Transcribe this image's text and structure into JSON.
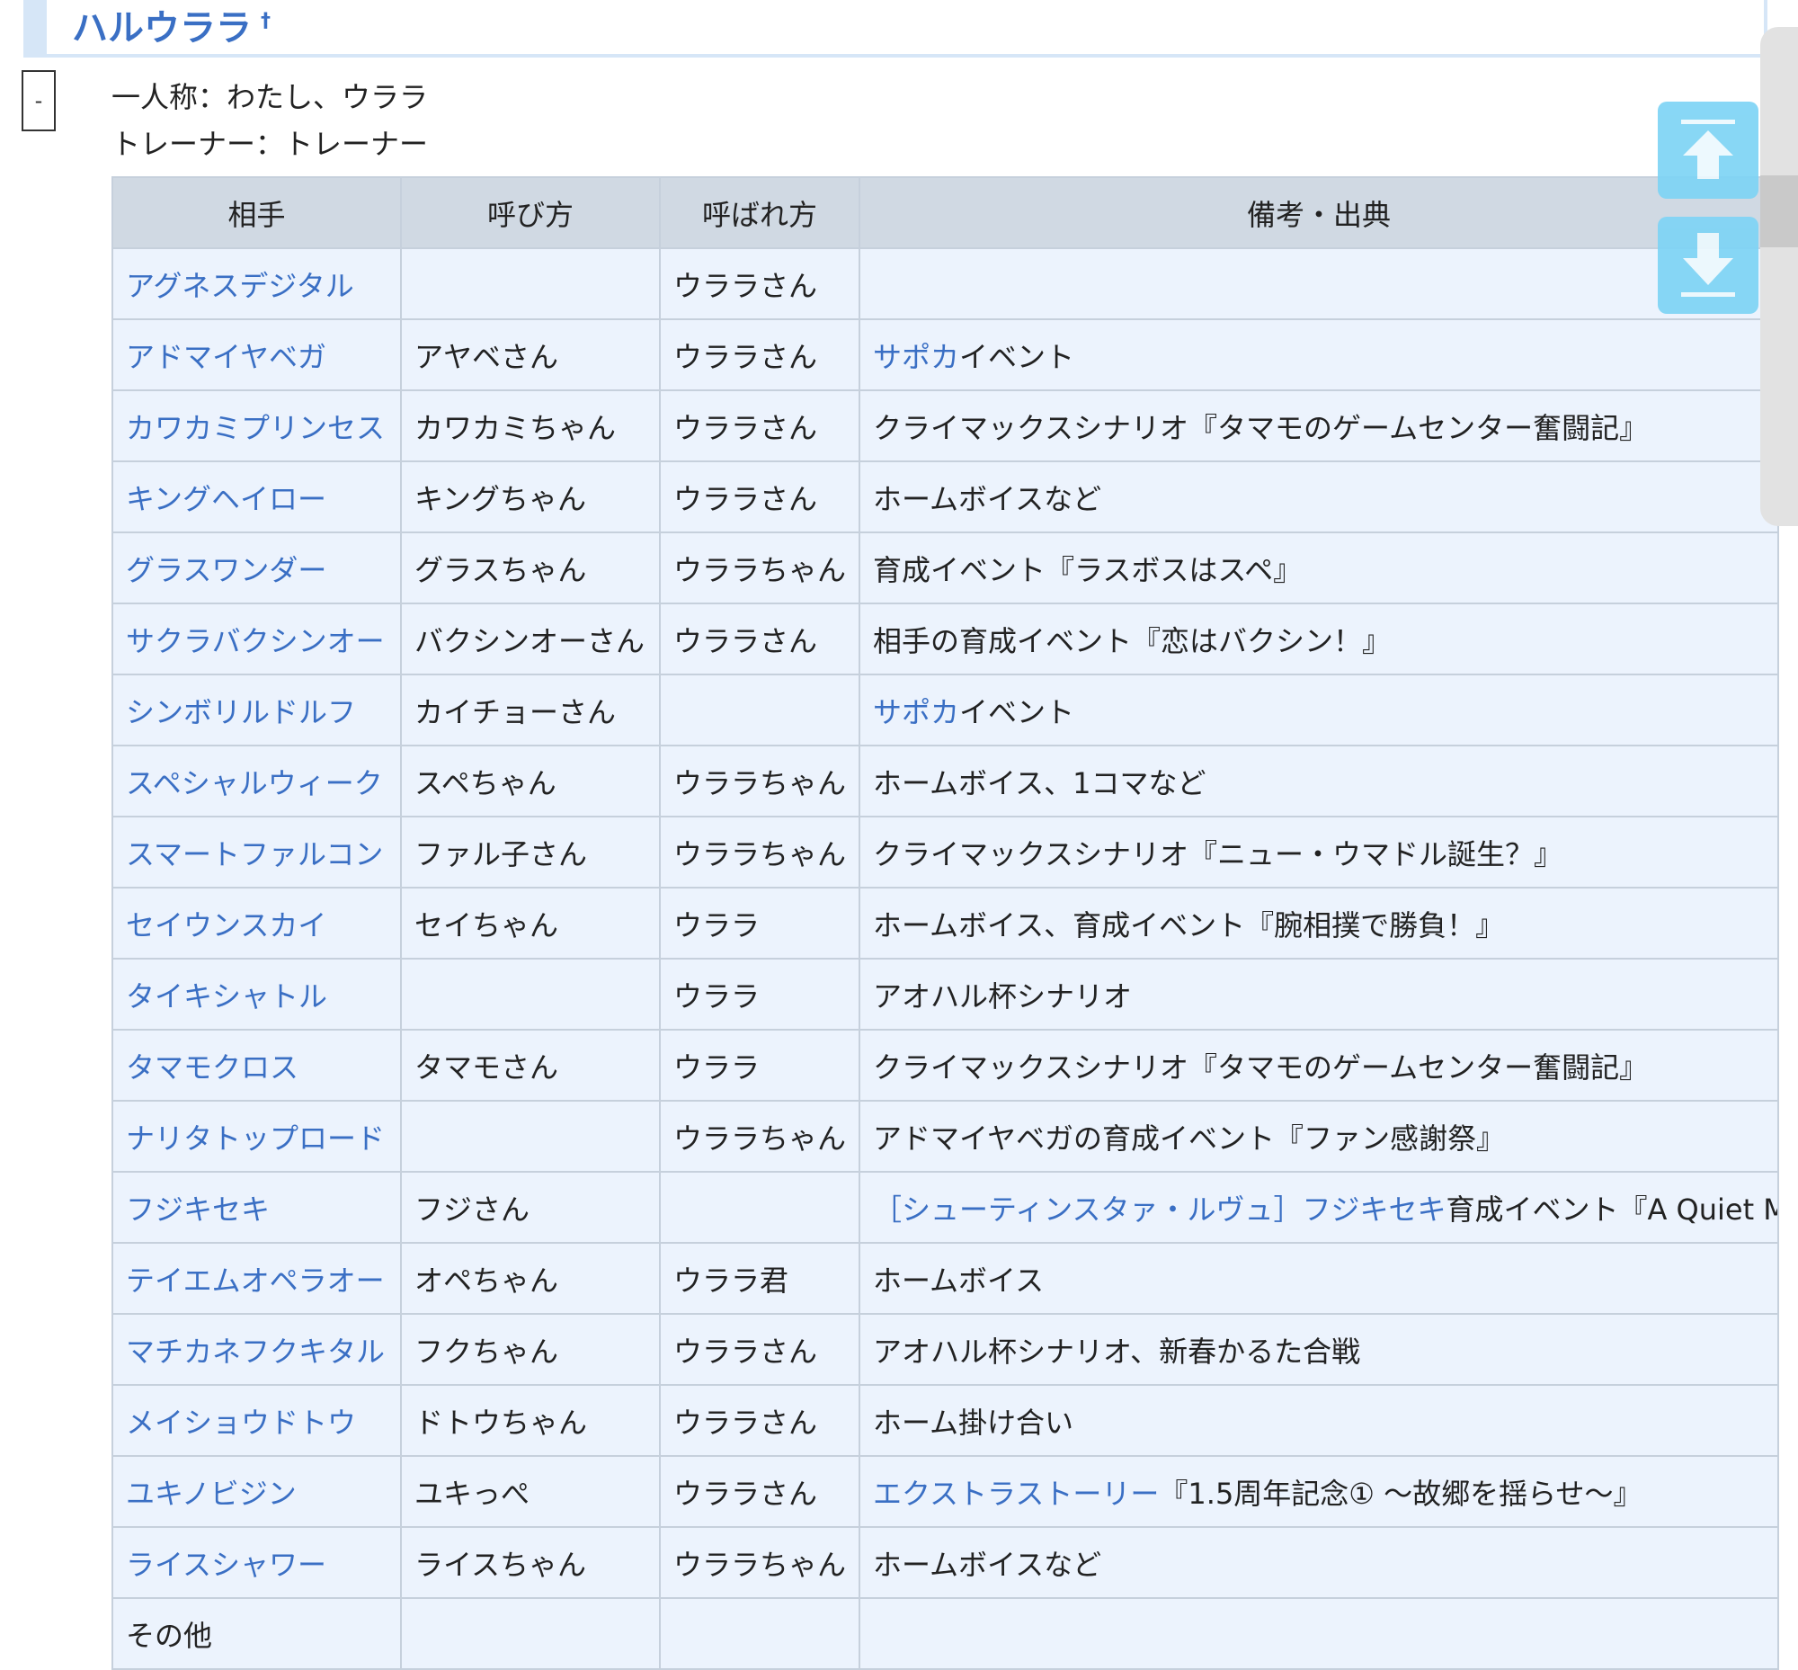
{
  "section": {
    "title": "ハルウララ",
    "anchor": "†",
    "toggle": "-"
  },
  "intro": {
    "first_person": "一人称：わたし、ウララ",
    "trainer": "トレーナー：トレーナー"
  },
  "table": {
    "headers": [
      "相手",
      "呼び方",
      "呼ばれ方",
      "備考・出典"
    ],
    "rows": [
      {
        "name": "アグネスデジタル",
        "calls": "",
        "called": "ウララさん",
        "note_link": "",
        "note": ""
      },
      {
        "name": "アドマイヤベガ",
        "calls": "アヤベさん",
        "called": "ウララさん",
        "note_link": "サポカ",
        "note": "イベント"
      },
      {
        "name": "カワカミプリンセス",
        "calls": "カワカミちゃん",
        "called": "ウララさん",
        "note_link": "",
        "note": "クライマックスシナリオ『タマモのゲームセンター奮闘記』"
      },
      {
        "name": "キングヘイロー",
        "calls": "キングちゃん",
        "called": "ウララさん",
        "note_link": "",
        "note": "ホームボイスなど"
      },
      {
        "name": "グラスワンダー",
        "calls": "グラスちゃん",
        "called": "ウララちゃん",
        "note_link": "",
        "note": "育成イベント『ラスボスはスペ』"
      },
      {
        "name": "サクラバクシンオー",
        "calls": "バクシンオーさん",
        "called": "ウララさん",
        "note_link": "",
        "note": "相手の育成イベント『恋はバクシン！』"
      },
      {
        "name": "シンボリルドルフ",
        "calls": "カイチョーさん",
        "called": "",
        "note_link": "サポカ",
        "note": "イベント"
      },
      {
        "name": "スペシャルウィーク",
        "calls": "スペちゃん",
        "called": "ウララちゃん",
        "note_link": "",
        "note": "ホームボイス、1コマなど"
      },
      {
        "name": "スマートファルコン",
        "calls": "ファル子さん",
        "called": "ウララちゃん",
        "note_link": "",
        "note": "クライマックスシナリオ『ニュー・ウマドル誕生？』"
      },
      {
        "name": "セイウンスカイ",
        "calls": "セイちゃん",
        "called": "ウララ",
        "note_link": "",
        "note": "ホームボイス、育成イベント『腕相撲で勝負！』"
      },
      {
        "name": "タイキシャトル",
        "calls": "",
        "called": "ウララ",
        "note_link": "",
        "note": "アオハル杯シナリオ"
      },
      {
        "name": "タマモクロス",
        "calls": "タマモさん",
        "called": "ウララ",
        "note_link": "",
        "note": "クライマックスシナリオ『タマモのゲームセンター奮闘記』"
      },
      {
        "name": "ナリタトップロード",
        "calls": "",
        "called": "ウララちゃん",
        "note_link": "",
        "note": "アドマイヤベガの育成イベント『ファン感謝祭』"
      },
      {
        "name": "フジキセキ",
        "calls": "フジさん",
        "called": "",
        "note_link": "［シューティンスタァ・ルヴュ］フジキセキ",
        "note": "育成イベント『A Quiet M"
      },
      {
        "name": "テイエムオペラオー",
        "calls": "オペちゃん",
        "called": "ウララ君",
        "note_link": "",
        "note": "ホームボイス"
      },
      {
        "name": "マチカネフクキタル",
        "calls": "フクちゃん",
        "called": "ウララさん",
        "note_link": "",
        "note": "アオハル杯シナリオ、新春かるた合戦"
      },
      {
        "name": "メイショウドトウ",
        "calls": "ドトウちゃん",
        "called": "ウララさん",
        "note_link": "",
        "note": "ホーム掛け合い"
      },
      {
        "name": "ユキノビジン",
        "calls": "ユキっぺ",
        "called": "ウララさん",
        "note_link": "エクストラストーリー",
        "note": "『1.5周年記念① ～故郷を揺らせ～』"
      },
      {
        "name": "ライスシャワー",
        "calls": "ライスちゃん",
        "called": "ウララちゃん",
        "note_link": "",
        "note": "ホームボイスなど"
      },
      {
        "name": "その他",
        "name_plain": true,
        "calls": "",
        "called": "",
        "note_link": "",
        "note": ""
      }
    ]
  },
  "scroll": {
    "up_icon": "arrow-up-to-top-icon",
    "down_icon": "arrow-down-to-bottom-icon",
    "color": "#7ed4f5"
  }
}
